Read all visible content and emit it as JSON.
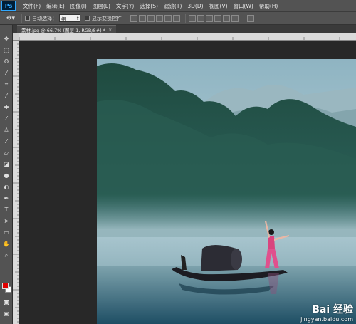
{
  "app": {
    "logo": "Ps"
  },
  "menu": [
    "文件(F)",
    "编辑(E)",
    "图像(I)",
    "图层(L)",
    "文字(Y)",
    "选择(S)",
    "滤镜(T)",
    "3D(D)",
    "视图(V)",
    "窗口(W)",
    "帮助(H)"
  ],
  "options": {
    "tool_icon": "move-tool-icon",
    "auto_select_label": "自动选择：",
    "auto_select_value": "组",
    "show_transform_label": "显示变换控件"
  },
  "document": {
    "tab_title": "素材.jpg @ 66.7% (图层 1, RGB/8#) *",
    "close_glyph": "×"
  },
  "colors": {
    "foreground": "#e00000",
    "background": "#ffffff"
  },
  "watermark": {
    "brand": "Bai 经验",
    "url": "jingyan.baidu.com"
  }
}
